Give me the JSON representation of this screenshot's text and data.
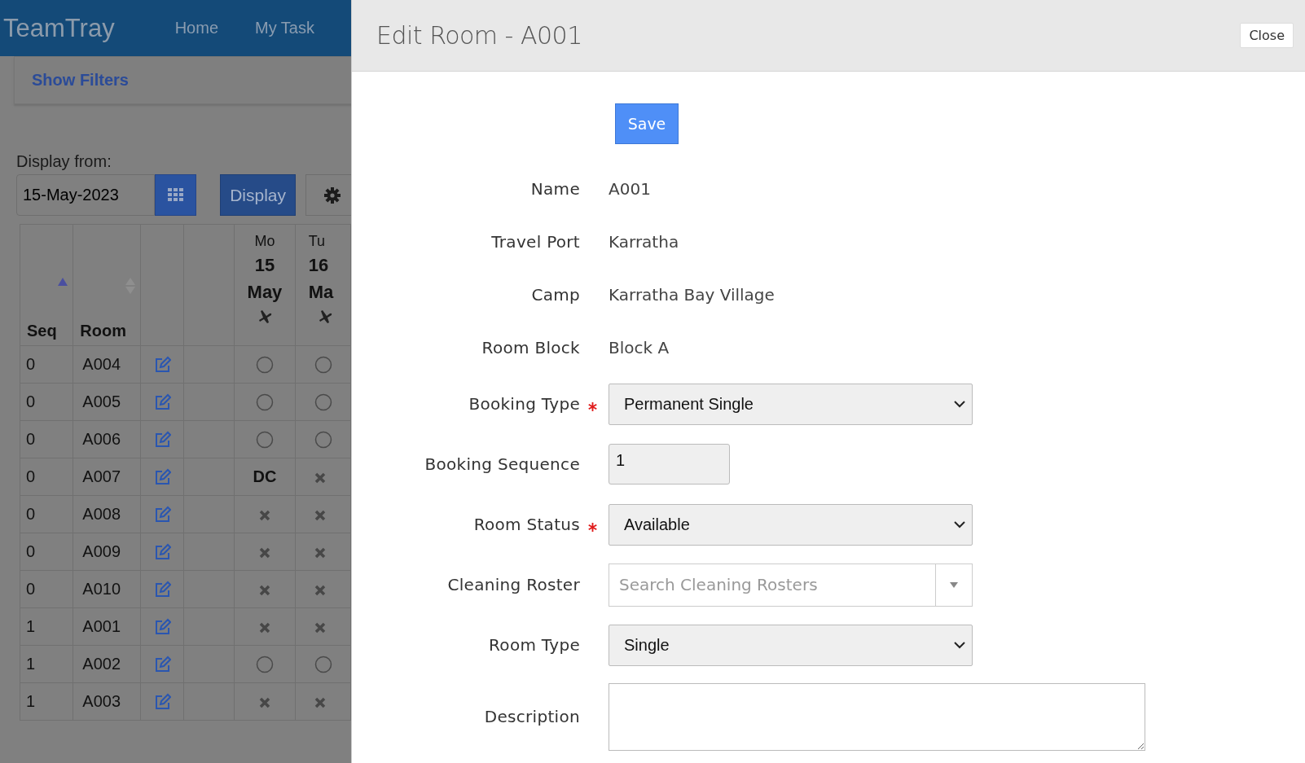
{
  "navbar": {
    "brand": "TeamTray",
    "links": [
      "Home",
      "My Task"
    ]
  },
  "filters": {
    "toggle": "Show Filters"
  },
  "display_from": {
    "label": "Display from:",
    "value": "15-May-2023",
    "button": "Display"
  },
  "table": {
    "columns": [
      {
        "label": "Seq",
        "kind": "sorted-ascending"
      },
      {
        "label": "Room",
        "kind": "sortable"
      }
    ],
    "days": [
      {
        "weekday": "Mo",
        "day": "15",
        "month": "May"
      },
      {
        "weekday": "Tu",
        "day": "16",
        "month": "Ma"
      }
    ],
    "rows": [
      {
        "seq": "0",
        "room": "A004",
        "days": [
          {
            "kind": "free"
          },
          {
            "kind": "free"
          }
        ]
      },
      {
        "seq": "0",
        "room": "A005",
        "days": [
          {
            "kind": "free"
          },
          {
            "kind": "free"
          }
        ]
      },
      {
        "seq": "0",
        "room": "A006",
        "days": [
          {
            "kind": "free"
          },
          {
            "kind": "free"
          }
        ]
      },
      {
        "seq": "0",
        "room": "A007",
        "days": [
          {
            "kind": "text",
            "text": "DC"
          },
          {
            "kind": "blocked"
          }
        ]
      },
      {
        "seq": "0",
        "room": "A008",
        "days": [
          {
            "kind": "blocked"
          },
          {
            "kind": "blocked"
          }
        ]
      },
      {
        "seq": "0",
        "room": "A009",
        "days": [
          {
            "kind": "blocked"
          },
          {
            "kind": "blocked"
          }
        ]
      },
      {
        "seq": "0",
        "room": "A010",
        "days": [
          {
            "kind": "blocked"
          },
          {
            "kind": "blocked"
          }
        ]
      },
      {
        "seq": "1",
        "room": "A001",
        "days": [
          {
            "kind": "blocked"
          },
          {
            "kind": "blocked"
          }
        ]
      },
      {
        "seq": "1",
        "room": "A002",
        "days": [
          {
            "kind": "free"
          },
          {
            "kind": "free"
          }
        ]
      },
      {
        "seq": "1",
        "room": "A003",
        "days": [
          {
            "kind": "blocked"
          },
          {
            "kind": "blocked"
          }
        ]
      }
    ]
  },
  "dialog": {
    "title": "Edit Room - A001",
    "close": "Close",
    "save": "Save",
    "fields": [
      {
        "kind": "text",
        "label": "Name",
        "required": false,
        "value": "A001"
      },
      {
        "kind": "text",
        "label": "Travel Port",
        "required": false,
        "value": "Karratha"
      },
      {
        "kind": "text",
        "label": "Camp",
        "required": false,
        "value": "Karratha Bay Village"
      },
      {
        "kind": "text",
        "label": "Room Block",
        "required": false,
        "value": "Block A"
      },
      {
        "kind": "select",
        "label": "Booking Type",
        "required": true,
        "value": "Permanent Single"
      },
      {
        "kind": "input",
        "label": "Booking Sequence",
        "required": false,
        "value": "1"
      },
      {
        "kind": "select",
        "label": "Room Status",
        "required": true,
        "value": "Available"
      },
      {
        "kind": "combo",
        "label": "Cleaning Roster",
        "required": false,
        "placeholder": "Search Cleaning Rosters"
      },
      {
        "kind": "select",
        "label": "Room Type",
        "required": false,
        "value": "Single"
      },
      {
        "kind": "textarea",
        "label": "Description",
        "required": false
      }
    ]
  }
}
